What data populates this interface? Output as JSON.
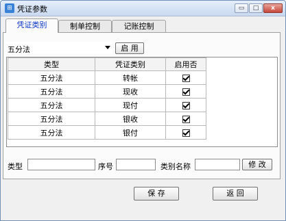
{
  "window": {
    "title": "凭证参数",
    "app_icon": "calc-icon",
    "controls": {
      "minimize": "▭",
      "maximize": "□",
      "close": "x"
    }
  },
  "tabs": [
    {
      "label": "凭证类别",
      "active": true
    },
    {
      "label": "制单控制",
      "active": false
    },
    {
      "label": "记账控制",
      "active": false
    }
  ],
  "toolbar": {
    "method_select": "五分法",
    "enable_label": "启 用"
  },
  "grid": {
    "headers": [
      "类型",
      "凭证类别",
      "启用否"
    ],
    "rows": [
      {
        "type": "五分法",
        "category": "转帐",
        "enabled": true
      },
      {
        "type": "五分法",
        "category": "现收",
        "enabled": true
      },
      {
        "type": "五分法",
        "category": "现付",
        "enabled": true
      },
      {
        "type": "五分法",
        "category": "银收",
        "enabled": true
      },
      {
        "type": "五分法",
        "category": "银付",
        "enabled": true
      }
    ]
  },
  "form": {
    "type_label": "类型",
    "type_value": "",
    "seq_label": "序号",
    "seq_value": "",
    "name_label": "类别名称",
    "name_value": "",
    "modify_label": "修 改"
  },
  "footer": {
    "save_label": "保 存",
    "back_label": "返 回"
  }
}
